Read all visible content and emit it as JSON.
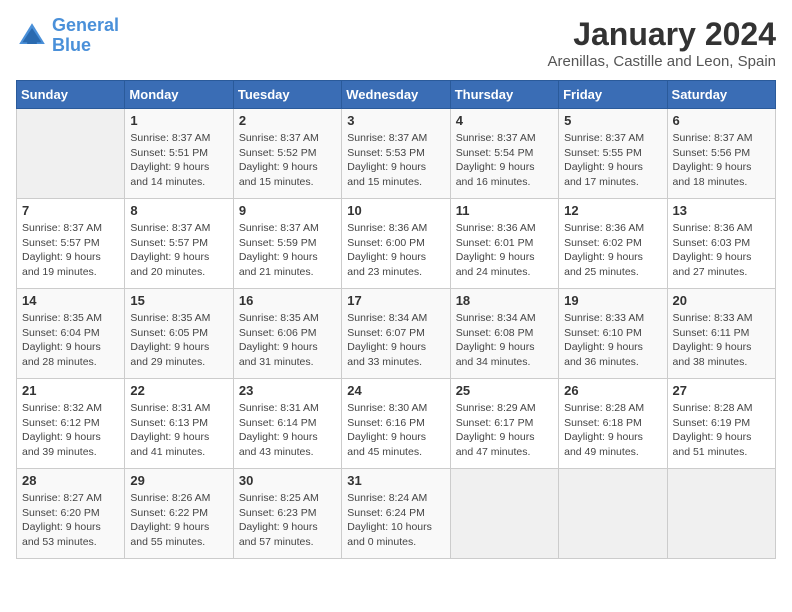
{
  "header": {
    "logo_line1": "General",
    "logo_line2": "Blue",
    "title": "January 2024",
    "subtitle": "Arenillas, Castille and Leon, Spain"
  },
  "days_of_week": [
    "Sunday",
    "Monday",
    "Tuesday",
    "Wednesday",
    "Thursday",
    "Friday",
    "Saturday"
  ],
  "weeks": [
    [
      {
        "day": "",
        "info": ""
      },
      {
        "day": "1",
        "info": "Sunrise: 8:37 AM\nSunset: 5:51 PM\nDaylight: 9 hours\nand 14 minutes."
      },
      {
        "day": "2",
        "info": "Sunrise: 8:37 AM\nSunset: 5:52 PM\nDaylight: 9 hours\nand 15 minutes."
      },
      {
        "day": "3",
        "info": "Sunrise: 8:37 AM\nSunset: 5:53 PM\nDaylight: 9 hours\nand 15 minutes."
      },
      {
        "day": "4",
        "info": "Sunrise: 8:37 AM\nSunset: 5:54 PM\nDaylight: 9 hours\nand 16 minutes."
      },
      {
        "day": "5",
        "info": "Sunrise: 8:37 AM\nSunset: 5:55 PM\nDaylight: 9 hours\nand 17 minutes."
      },
      {
        "day": "6",
        "info": "Sunrise: 8:37 AM\nSunset: 5:56 PM\nDaylight: 9 hours\nand 18 minutes."
      }
    ],
    [
      {
        "day": "7",
        "info": "Sunrise: 8:37 AM\nSunset: 5:57 PM\nDaylight: 9 hours\nand 19 minutes."
      },
      {
        "day": "8",
        "info": "Sunrise: 8:37 AM\nSunset: 5:57 PM\nDaylight: 9 hours\nand 20 minutes."
      },
      {
        "day": "9",
        "info": "Sunrise: 8:37 AM\nSunset: 5:59 PM\nDaylight: 9 hours\nand 21 minutes."
      },
      {
        "day": "10",
        "info": "Sunrise: 8:36 AM\nSunset: 6:00 PM\nDaylight: 9 hours\nand 23 minutes."
      },
      {
        "day": "11",
        "info": "Sunrise: 8:36 AM\nSunset: 6:01 PM\nDaylight: 9 hours\nand 24 minutes."
      },
      {
        "day": "12",
        "info": "Sunrise: 8:36 AM\nSunset: 6:02 PM\nDaylight: 9 hours\nand 25 minutes."
      },
      {
        "day": "13",
        "info": "Sunrise: 8:36 AM\nSunset: 6:03 PM\nDaylight: 9 hours\nand 27 minutes."
      }
    ],
    [
      {
        "day": "14",
        "info": "Sunrise: 8:35 AM\nSunset: 6:04 PM\nDaylight: 9 hours\nand 28 minutes."
      },
      {
        "day": "15",
        "info": "Sunrise: 8:35 AM\nSunset: 6:05 PM\nDaylight: 9 hours\nand 29 minutes."
      },
      {
        "day": "16",
        "info": "Sunrise: 8:35 AM\nSunset: 6:06 PM\nDaylight: 9 hours\nand 31 minutes."
      },
      {
        "day": "17",
        "info": "Sunrise: 8:34 AM\nSunset: 6:07 PM\nDaylight: 9 hours\nand 33 minutes."
      },
      {
        "day": "18",
        "info": "Sunrise: 8:34 AM\nSunset: 6:08 PM\nDaylight: 9 hours\nand 34 minutes."
      },
      {
        "day": "19",
        "info": "Sunrise: 8:33 AM\nSunset: 6:10 PM\nDaylight: 9 hours\nand 36 minutes."
      },
      {
        "day": "20",
        "info": "Sunrise: 8:33 AM\nSunset: 6:11 PM\nDaylight: 9 hours\nand 38 minutes."
      }
    ],
    [
      {
        "day": "21",
        "info": "Sunrise: 8:32 AM\nSunset: 6:12 PM\nDaylight: 9 hours\nand 39 minutes."
      },
      {
        "day": "22",
        "info": "Sunrise: 8:31 AM\nSunset: 6:13 PM\nDaylight: 9 hours\nand 41 minutes."
      },
      {
        "day": "23",
        "info": "Sunrise: 8:31 AM\nSunset: 6:14 PM\nDaylight: 9 hours\nand 43 minutes."
      },
      {
        "day": "24",
        "info": "Sunrise: 8:30 AM\nSunset: 6:16 PM\nDaylight: 9 hours\nand 45 minutes."
      },
      {
        "day": "25",
        "info": "Sunrise: 8:29 AM\nSunset: 6:17 PM\nDaylight: 9 hours\nand 47 minutes."
      },
      {
        "day": "26",
        "info": "Sunrise: 8:28 AM\nSunset: 6:18 PM\nDaylight: 9 hours\nand 49 minutes."
      },
      {
        "day": "27",
        "info": "Sunrise: 8:28 AM\nSunset: 6:19 PM\nDaylight: 9 hours\nand 51 minutes."
      }
    ],
    [
      {
        "day": "28",
        "info": "Sunrise: 8:27 AM\nSunset: 6:20 PM\nDaylight: 9 hours\nand 53 minutes."
      },
      {
        "day": "29",
        "info": "Sunrise: 8:26 AM\nSunset: 6:22 PM\nDaylight: 9 hours\nand 55 minutes."
      },
      {
        "day": "30",
        "info": "Sunrise: 8:25 AM\nSunset: 6:23 PM\nDaylight: 9 hours\nand 57 minutes."
      },
      {
        "day": "31",
        "info": "Sunrise: 8:24 AM\nSunset: 6:24 PM\nDaylight: 10 hours\nand 0 minutes."
      },
      {
        "day": "",
        "info": ""
      },
      {
        "day": "",
        "info": ""
      },
      {
        "day": "",
        "info": ""
      }
    ]
  ]
}
